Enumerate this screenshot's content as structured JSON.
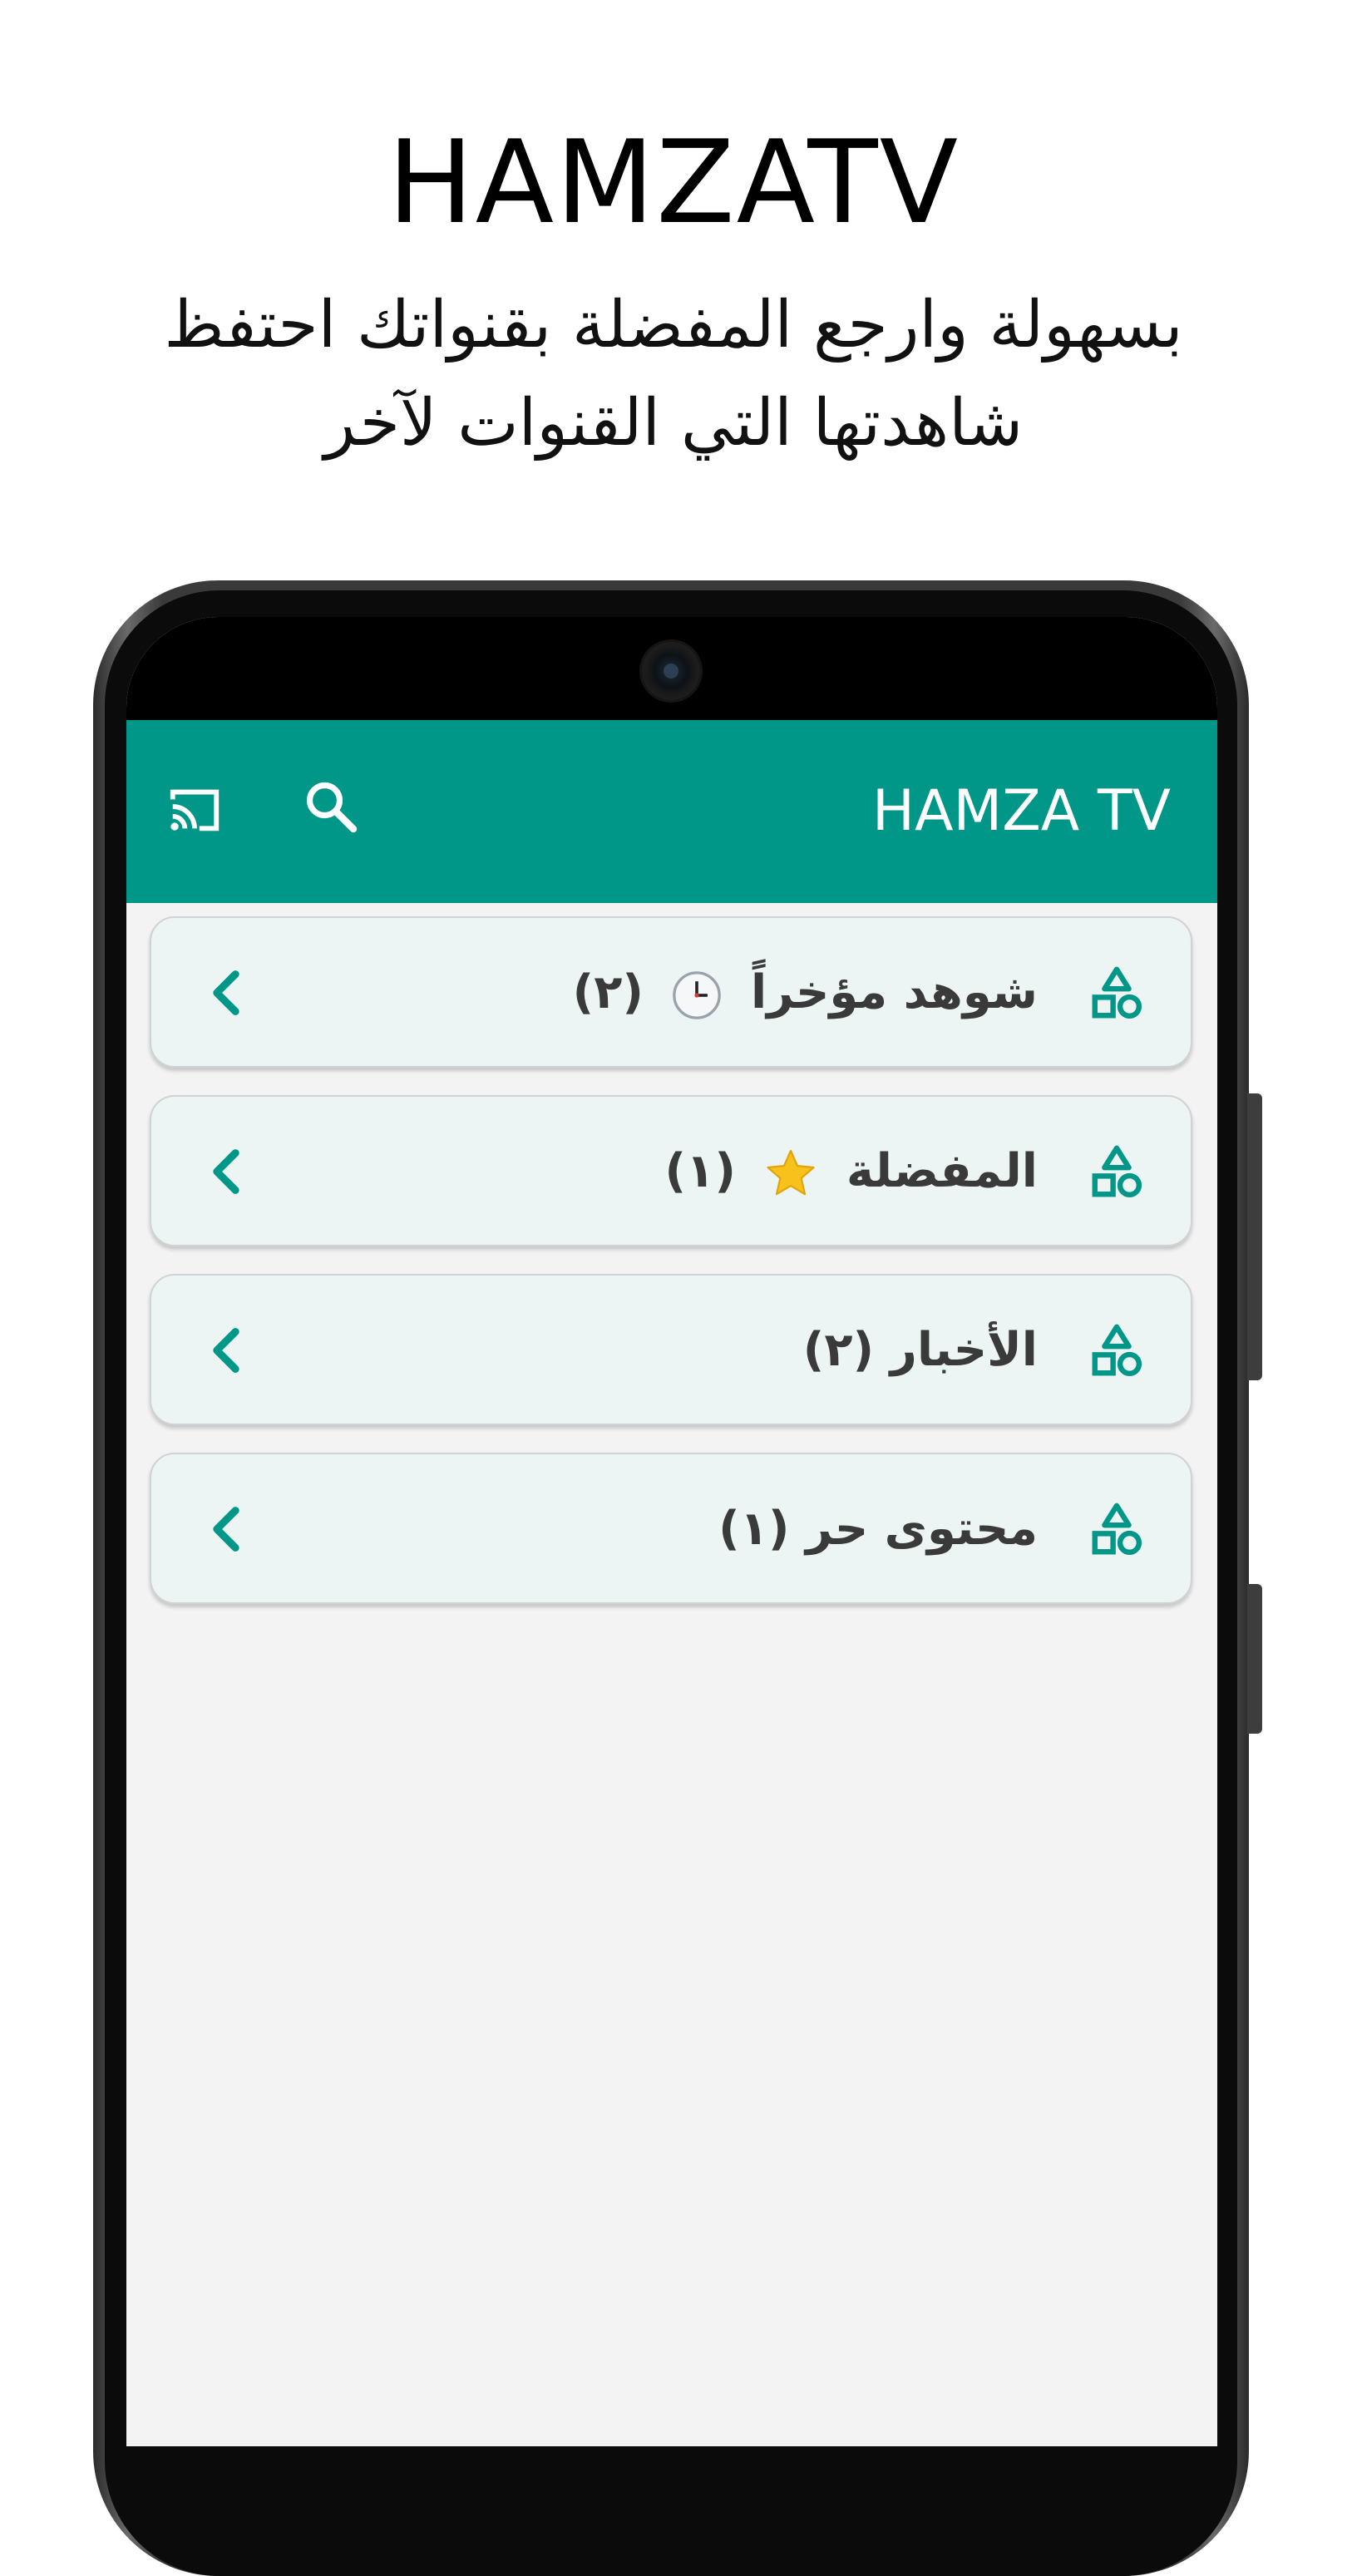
{
  "promo": {
    "title": "HAMZATV",
    "subtitle_line1": "بسهولة وارجع المفضلة بقنواتك احتفظ",
    "subtitle_line2": "شاهدتها التي القنوات لآخر"
  },
  "app": {
    "title": "HAMZA TV",
    "accent_color": "#009688",
    "toolbar": {
      "cast_icon": "cast-icon",
      "search_icon": "search-icon"
    }
  },
  "categories": [
    {
      "label": "شوهد مؤخراً",
      "count": "(٢)",
      "emoji_icon": "clock-icon",
      "row_icon": "category-shapes-icon"
    },
    {
      "label": "المفضلة",
      "count": "(١)",
      "emoji_icon": "star-icon",
      "row_icon": "category-shapes-icon"
    },
    {
      "label": "الأخبار",
      "count": "(٢)",
      "emoji_icon": "",
      "row_icon": "category-shapes-icon"
    },
    {
      "label": "محتوى حر",
      "count": "(١)",
      "emoji_icon": "",
      "row_icon": "category-shapes-icon"
    }
  ]
}
